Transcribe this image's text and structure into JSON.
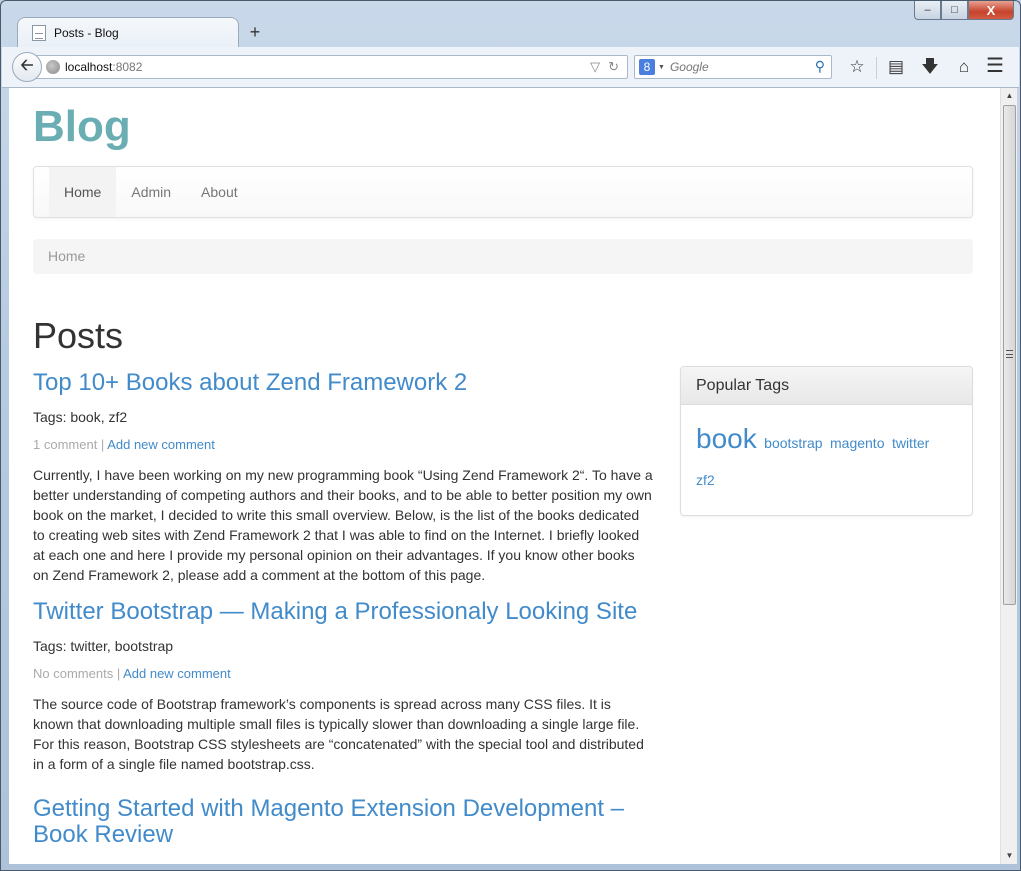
{
  "window": {
    "controls": {
      "minimize": "—",
      "maximize": "□",
      "close": "X"
    }
  },
  "browser": {
    "tab_title": "Posts - Blog",
    "new_tab": "+",
    "url_host": "localhost",
    "url_port": ":8082",
    "search_engine": "8",
    "search_placeholder": "Google",
    "icons": [
      "star-icon",
      "reading-list-icon",
      "download-icon",
      "home-icon",
      "menu-icon"
    ]
  },
  "site": {
    "brand": "Blog",
    "nav": [
      {
        "label": "Home",
        "active": true
      },
      {
        "label": "Admin",
        "active": false
      },
      {
        "label": "About",
        "active": false
      }
    ],
    "breadcrumb": "Home",
    "page_title": "Posts"
  },
  "posts": [
    {
      "title": "Top 10+ Books about Zend Framework 2",
      "tags": "Tags: book, zf2",
      "comments": "1 comment",
      "separator": " | ",
      "add_comment": "Add new comment",
      "body": "Currently, I have been working on my new programming book “Using Zend Framework 2“. To have a better understanding of competing authors and their books, and to be able to better position my own book on the market, I decided to write this small overview. Below, is the list of the books dedicated to creating web sites with Zend Framework 2 that I was able to find on the Internet. I briefly looked at each one and here I provide my personal opinion on their advantages. If you know other books on Zend Framework 2, please add a comment at the bottom of this page."
    },
    {
      "title": "Twitter Bootstrap — Making a Professionaly Looking Site",
      "tags": "Tags: twitter, bootstrap",
      "comments": "No comments",
      "separator": " | ",
      "add_comment": "Add new comment",
      "body": "The source code of Bootstrap framework’s components is spread across many CSS files. It is known that downloading multiple small files is typically slower than downloading a single large file. For this reason, Bootstrap CSS stylesheets are “concatenated” with the special tool and distributed in a form of a single file named bootstrap.css."
    },
    {
      "title": "Getting Started with Magento Extension Development – Book Review"
    }
  ],
  "sidebar": {
    "title": "Popular Tags",
    "tags": [
      "book",
      "bootstrap",
      "magento",
      "twitter",
      "zf2"
    ]
  },
  "colors": {
    "brand": "#6aaeb4",
    "link": "#428bca",
    "muted": "#aaaaaa"
  }
}
